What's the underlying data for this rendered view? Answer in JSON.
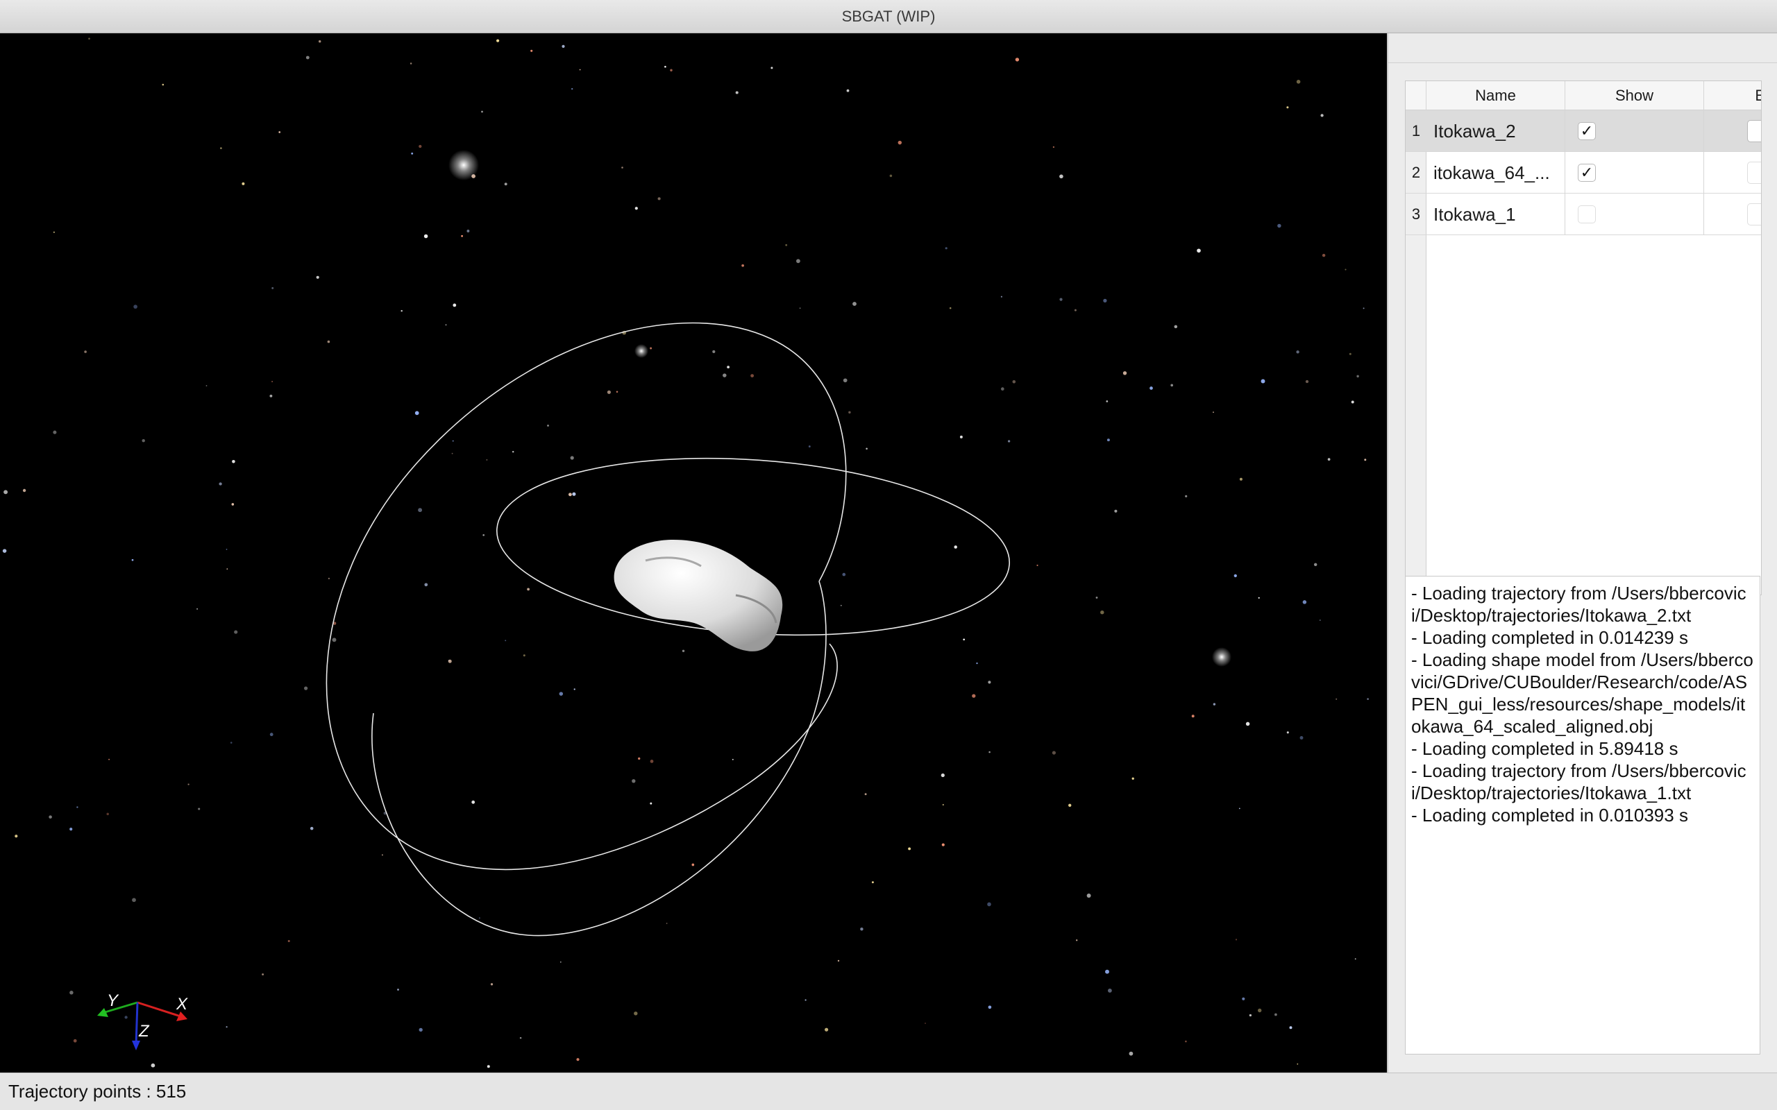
{
  "window": {
    "title": "SBGAT (WIP)"
  },
  "table": {
    "columns": [
      "Name",
      "Show",
      "E"
    ],
    "rows": [
      {
        "index": "1",
        "name": "Itokawa_2",
        "show": true,
        "selected": true
      },
      {
        "index": "2",
        "name": "itokawa_64_...",
        "show": true,
        "selected": false
      },
      {
        "index": "3",
        "name": "Itokawa_1",
        "show": false,
        "selected": false
      }
    ]
  },
  "console": {
    "lines": [
      "- Loading trajectory from /Users/bbercovici/Desktop/trajectories/Itokawa_2.txt",
      "- Loading completed in 0.014239 s",
      "- Loading shape model from /Users/bbercovici/GDrive/CUBoulder/Research/code/ASPEN_gui_less/resources/shape_models/itokawa_64_scaled_aligned.obj",
      "- Loading completed in 5.89418 s",
      "- Loading trajectory from /Users/bbercovici/Desktop/trajectories/Itokawa_1.txt",
      "- Loading completed in 0.010393 s"
    ]
  },
  "viewport": {
    "axes": {
      "x_label": "X",
      "y_label": "Y",
      "z_label": "Z"
    }
  },
  "status": {
    "text": "Trajectory points : 515"
  }
}
